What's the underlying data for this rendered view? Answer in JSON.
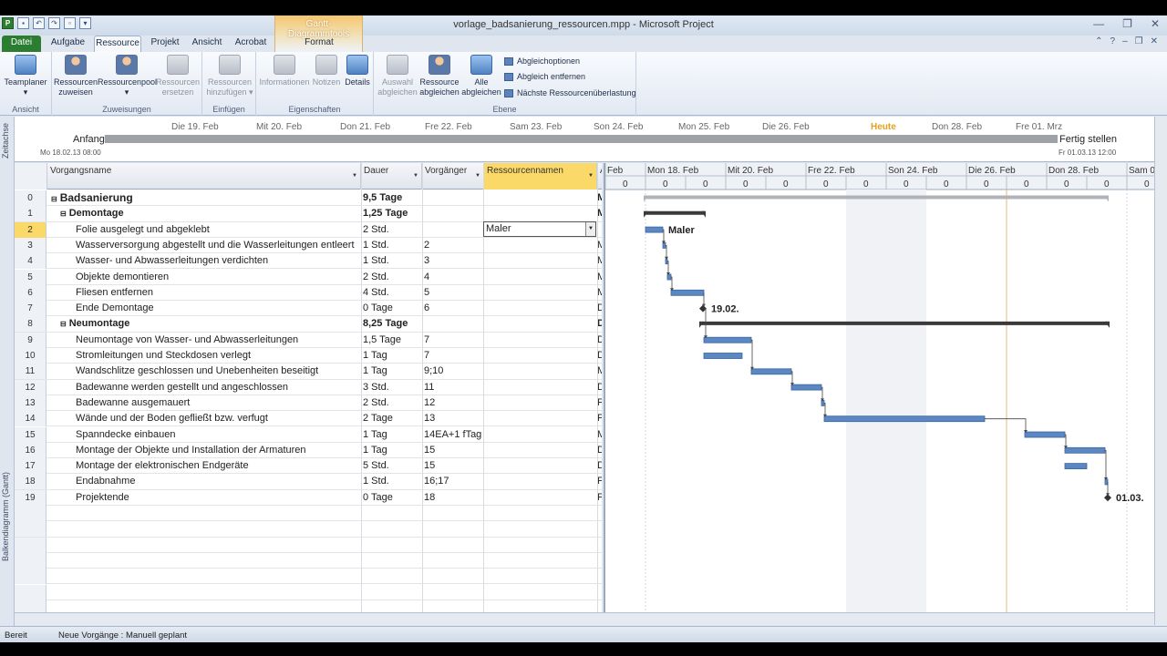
{
  "window": {
    "title": "vorlage_badsanierung_ressourcen.mpp - Microsoft Project",
    "context_tools": "Gantt-Diagrammtools"
  },
  "tabs": [
    {
      "label": "Datei"
    },
    {
      "label": "Aufgabe"
    },
    {
      "label": "Ressource"
    },
    {
      "label": "Projekt"
    },
    {
      "label": "Ansicht"
    },
    {
      "label": "Acrobat"
    },
    {
      "label": "Format"
    }
  ],
  "ribbon": {
    "groups": {
      "ansicht": "Ansicht",
      "zuweisungen": "Zuweisungen",
      "einfuegen": "Einfügen",
      "eigenschaften": "Eigenschaften",
      "ebene": "Ebene"
    },
    "buttons": {
      "teamplaner": "Teamplaner",
      "ressourcen_zuweisen_1": "Ressourcen",
      "ressourcen_zuweisen_2": "zuweisen",
      "ressourcenpool": "Ressourcenpool",
      "ressourcen_ersetzen_1": "Ressourcen",
      "ressourcen_ersetzen_2": "ersetzen",
      "ressourcen_hinzufuegen_1": "Ressourcen",
      "ressourcen_hinzufuegen_2": "hinzufügen",
      "informationen": "Informationen",
      "notizen": "Notizen",
      "details": "Details",
      "auswahl_1": "Auswahl",
      "auswahl_2": "abgleichen",
      "ressource_abgleichen_1": "Ressource",
      "ressource_abgleichen_2": "abgleichen",
      "alle_1": "Alle",
      "alle_2": "abgleichen",
      "abgleichoptionen": "Abgleichoptionen",
      "abgleich_entfernen": "Abgleich entfernen",
      "naechste": "Nächste Ressourcenüberlastung"
    }
  },
  "timeline": {
    "dates": [
      "Die 19. Feb",
      "Mit 20. Feb",
      "Don 21. Feb",
      "Fre 22. Feb",
      "Sam 23. Feb",
      "Son 24. Feb",
      "Mon 25. Feb",
      "Die 26. Feb",
      "Heute",
      "Don 28. Feb",
      "Fre 01. Mrz"
    ],
    "start_label": "Anfang",
    "start_date": "Mo 18.02.13 08:00",
    "end_label": "Fertig stellen",
    "end_date": "Fr 01.03.13 12:00",
    "side_label": "Zeitachse"
  },
  "side_label": "Balkendiagramm (Gantt)",
  "grid": {
    "headers": {
      "name": "Vorgangsname",
      "dur": "Dauer",
      "pred": "Vorgänger",
      "res": "Ressourcennamen",
      "more": "A"
    },
    "rows": [
      {
        "id": "0",
        "name": "Badsanierung",
        "dur": "9,5 Tage",
        "pred": "",
        "res": "M",
        "level": 0,
        "summary": true
      },
      {
        "id": "1",
        "name": "Demontage",
        "dur": "1,25 Tage",
        "pred": "",
        "res": "M",
        "level": 1,
        "summary": true
      },
      {
        "id": "2",
        "name": "Folie ausgelegt und abgeklebt",
        "dur": "2 Std.",
        "pred": "",
        "res": "Maler",
        "level": 2,
        "summary": false
      },
      {
        "id": "3",
        "name": "Wasserversorgung abgestellt und die Wasserleitungen entleert",
        "dur": "1 Std.",
        "pred": "2",
        "res": "M",
        "level": 2,
        "summary": false
      },
      {
        "id": "4",
        "name": "Wasser- und Abwasserleitungen verdichten",
        "dur": "1 Std.",
        "pred": "3",
        "res": "M",
        "level": 2,
        "summary": false
      },
      {
        "id": "5",
        "name": "Objekte demontieren",
        "dur": "2 Std.",
        "pred": "4",
        "res": "M",
        "level": 2,
        "summary": false
      },
      {
        "id": "6",
        "name": "Fliesen entfernen",
        "dur": "4 Std.",
        "pred": "5",
        "res": "M",
        "level": 2,
        "summary": false
      },
      {
        "id": "7",
        "name": "Ende Demontage",
        "dur": "0 Tage",
        "pred": "6",
        "res": "D",
        "level": 2,
        "summary": false
      },
      {
        "id": "8",
        "name": "Neumontage",
        "dur": "8,25 Tage",
        "pred": "",
        "res": "D",
        "level": 1,
        "summary": true
      },
      {
        "id": "9",
        "name": "Neumontage von Wasser- und Abwasserleitungen",
        "dur": "1,5 Tage",
        "pred": "7",
        "res": "D",
        "level": 2,
        "summary": false
      },
      {
        "id": "10",
        "name": "Stromleitungen und Steckdosen verlegt",
        "dur": "1 Tag",
        "pred": "7",
        "res": "D",
        "level": 2,
        "summary": false
      },
      {
        "id": "11",
        "name": "Wandschlitze geschlossen und Unebenheiten beseitigt",
        "dur": "1 Tag",
        "pred": "9;10",
        "res": "M",
        "level": 2,
        "summary": false
      },
      {
        "id": "12",
        "name": "Badewanne werden gestellt und angeschlossen",
        "dur": "3 Std.",
        "pred": "11",
        "res": "D",
        "level": 2,
        "summary": false
      },
      {
        "id": "13",
        "name": "Badewanne ausgemauert",
        "dur": "2 Std.",
        "pred": "12",
        "res": "F",
        "level": 2,
        "summary": false
      },
      {
        "id": "14",
        "name": "Wände und der Boden gefließt bzw. verfugt",
        "dur": "2 Tage",
        "pred": "13",
        "res": "F",
        "level": 2,
        "summary": false
      },
      {
        "id": "15",
        "name": "Spanndecke einbauen",
        "dur": "1 Tag",
        "pred": "14EA+1 fTag",
        "res": "M",
        "level": 2,
        "summary": false
      },
      {
        "id": "16",
        "name": "Montage der Objekte und Installation der Armaturen",
        "dur": "1 Tag",
        "pred": "15",
        "res": "D",
        "level": 2,
        "summary": false
      },
      {
        "id": "17",
        "name": "Montage der elektronischen Endgeräte",
        "dur": "5 Std.",
        "pred": "15",
        "res": "D",
        "level": 2,
        "summary": false
      },
      {
        "id": "18",
        "name": "Endabnahme",
        "dur": "1 Std.",
        "pred": "16;17",
        "res": "F",
        "level": 2,
        "summary": false
      },
      {
        "id": "19",
        "name": "Projektende",
        "dur": "0 Tage",
        "pred": "18",
        "res": "F",
        "level": 2,
        "summary": false
      }
    ],
    "selected_row": "2",
    "editor_value": "Maler"
  },
  "gantt": {
    "upper_scale": [
      "Feb",
      "Mon 18. Feb",
      "Mit 20. Feb",
      "Fre 22. Feb",
      "Son 24. Feb",
      "Die 26. Feb",
      "Don 28. Feb",
      "Sam 0"
    ],
    "lower_tick": "0",
    "labels": {
      "maler": "Maler",
      "end_demontage": "19.02.",
      "end_project": "01.03."
    }
  },
  "status": {
    "ready": "Bereit",
    "new_tasks": "Neue Vorgänge : Manuell geplant"
  },
  "colors": {
    "file_tab": "#2b7d2f",
    "selection": "#fbd968",
    "bar": "#4f7fbf",
    "today": "#e0a21c"
  }
}
